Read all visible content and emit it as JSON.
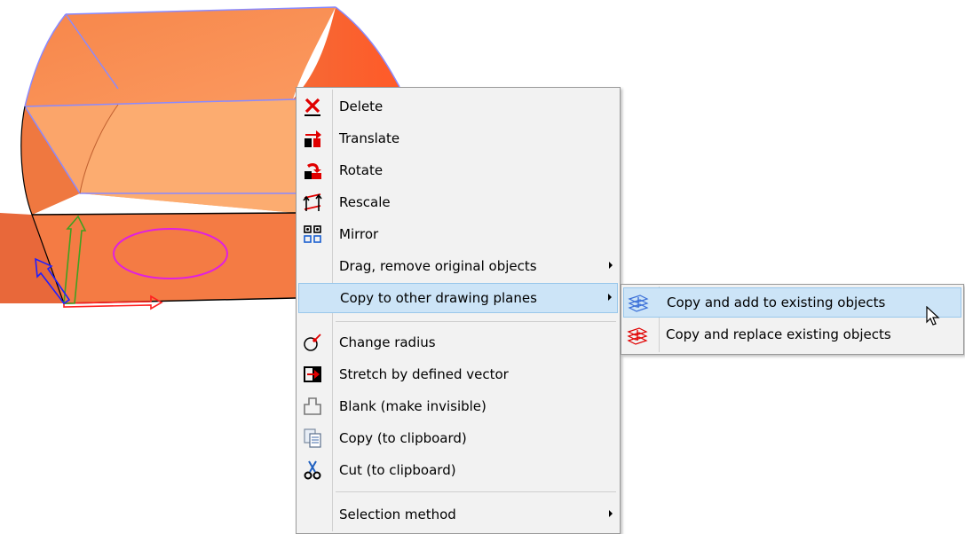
{
  "context_menu": {
    "items": [
      {
        "label": "Delete",
        "icon": "delete-x-icon"
      },
      {
        "label": "Translate",
        "icon": "translate-icon"
      },
      {
        "label": "Rotate",
        "icon": "rotate-icon"
      },
      {
        "label": "Rescale",
        "icon": "rescale-icon"
      },
      {
        "label": "Mirror",
        "icon": "mirror-icon"
      },
      {
        "label": "Drag, remove original objects",
        "has_submenu": true
      },
      {
        "label": "Copy to other drawing planes",
        "has_submenu": true,
        "highlighted": true
      },
      {
        "label": "Change radius",
        "icon": "change-radius-icon"
      },
      {
        "label": "Stretch by defined vector",
        "icon": "stretch-icon"
      },
      {
        "label": "Blank (make invisible)",
        "icon": "blank-icon"
      },
      {
        "label": "Copy (to clipboard)",
        "icon": "copy-icon"
      },
      {
        "label": "Cut (to clipboard)",
        "icon": "scissors-icon"
      },
      {
        "label": "Selection method",
        "has_submenu": true
      }
    ]
  },
  "submenu": {
    "items": [
      {
        "label": "Copy and add to existing objects",
        "icon": "copy-add-planes-icon",
        "highlighted": true
      },
      {
        "label": "Copy and replace existing objects",
        "icon": "copy-replace-planes-icon"
      }
    ]
  },
  "colors": {
    "solid_face": "#f68a52",
    "solid_edge": "#8a8aff",
    "ellipse": "#e020e0",
    "menu_bg": "#f2f2f2",
    "highlight": "#cce4f7",
    "axis_x": "#ff2020",
    "axis_y": "#40a020",
    "axis_z": "#2020ff"
  }
}
